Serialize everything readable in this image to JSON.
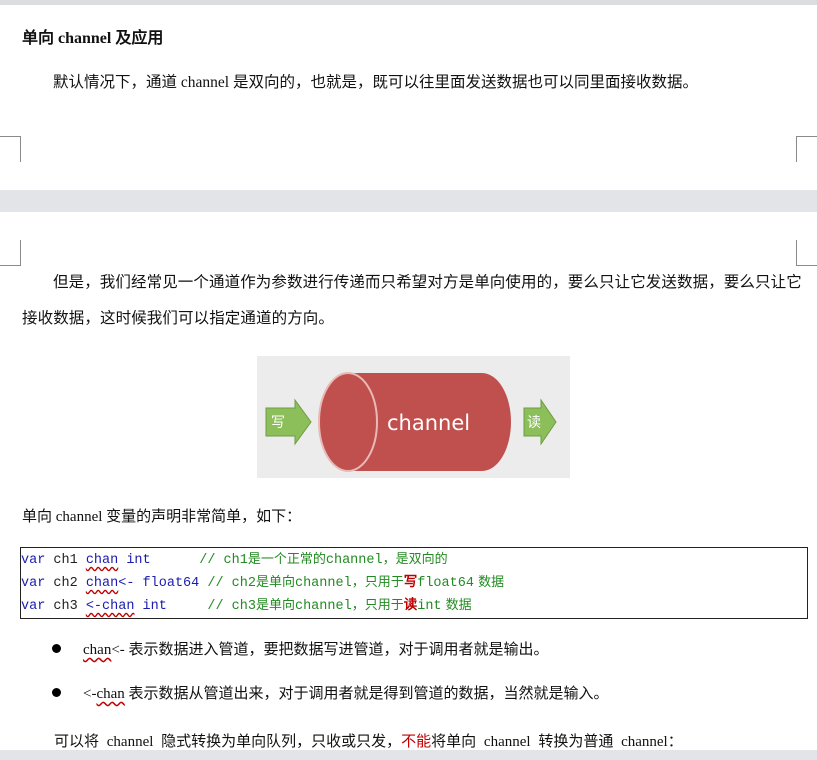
{
  "page1": {
    "heading": "单向 channel 及应用",
    "paragraph": "默认情况下，通道 channel 是双向的，也就是，既可以往里面发送数据也可以同里面接收数据。"
  },
  "page2": {
    "paragraph": "但是，我们经常见一个通道作为参数进行传递而只希望对方是单向使用的，要么只让它发送数据，要么只让它接收数据，这时候我们可以指定通道的方向。",
    "diagram": {
      "write_label": "写",
      "channel_label": "channel",
      "read_label": "读",
      "colors": {
        "cylinder": "#c0504d",
        "arrow": "#8cbf5a",
        "background": "#ececec"
      }
    },
    "declaration_intro": "单向 channel 变量的声明非常简单，如下：",
    "code": [
      {
        "kw": "var",
        "name": " ch1 ",
        "type": "chan",
        "type2": " int",
        "pad": "      ",
        "comment_a": "// ch1",
        "comment_b": "是一个正常的",
        "comment_c": "channel",
        "comment_d": "，是双向的"
      },
      {
        "kw": "var",
        "name": " ch2 ",
        "type": "chan",
        "type2": "<- float64",
        "pad": " ",
        "comment_a": "// ch2",
        "comment_b": "是单向",
        "comment_c": "channel",
        "comment_d": "，只用于",
        "highlight": "写",
        "comment_e": "float64",
        "comment_f": " 数据"
      },
      {
        "kw": "var",
        "name": " ch3 ",
        "type": "<-chan",
        "type2": " int",
        "pad": "     ",
        "comment_a": "// ch3",
        "comment_b": "是单向",
        "comment_c": "channel",
        "comment_d": "，只用于",
        "highlight": "读",
        "comment_e": "int",
        "comment_f": " 数据"
      }
    ],
    "bullets": [
      {
        "code": "chan",
        "suffix": "<-",
        "text": " 表示数据进入管道，要把数据写进管道，对于调用者就是输出。"
      },
      {
        "prefix": "<-",
        "code": "chan",
        "text": " 表示数据从管道出来，对于调用者就是得到管道的数据，当然就是输入。"
      }
    ],
    "closing_a": "可以将 channel 隐式转换为单向队列，只收或只发，",
    "closing_red": "不能",
    "closing_b": "将单向 channel 转换为普通 channel："
  }
}
